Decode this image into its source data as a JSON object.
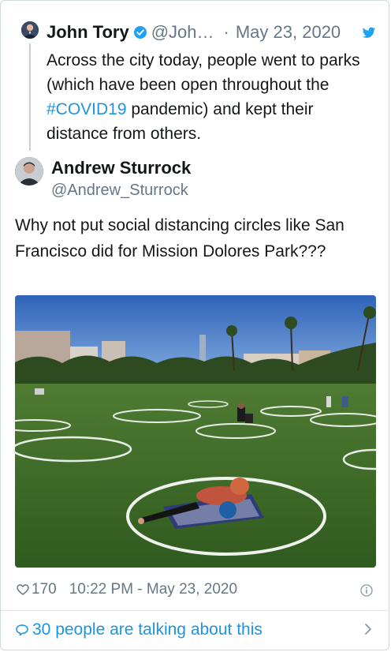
{
  "quoted": {
    "name": "John Tory",
    "handle": "@Joh…",
    "separator": "·",
    "date": "May 23, 2020",
    "text_before": "Across the city today, people went to parks (which have been open throughout the ",
    "hashtag": "#COVID19",
    "text_after": " pandemic) and kept their distance from others."
  },
  "tweet": {
    "name": "Andrew Sturrock",
    "handle": "@Andrew_Sturrock",
    "text": "Why not put social distancing circles like San Francisco did for Mission Dolores Park???",
    "likes": "170",
    "timestamp": "10:22 PM - May 23, 2020"
  },
  "footer": {
    "talking": "30 people are talking about this"
  },
  "icons": {
    "verified": "verified-badge-icon",
    "bird": "twitter-bird-icon",
    "like": "heart-icon",
    "info": "info-icon",
    "reply": "speech-bubble-icon",
    "chevron": "chevron-right-icon"
  },
  "colors": {
    "link": "#1b95e0",
    "secondary": "#657786",
    "text": "#14171a"
  }
}
